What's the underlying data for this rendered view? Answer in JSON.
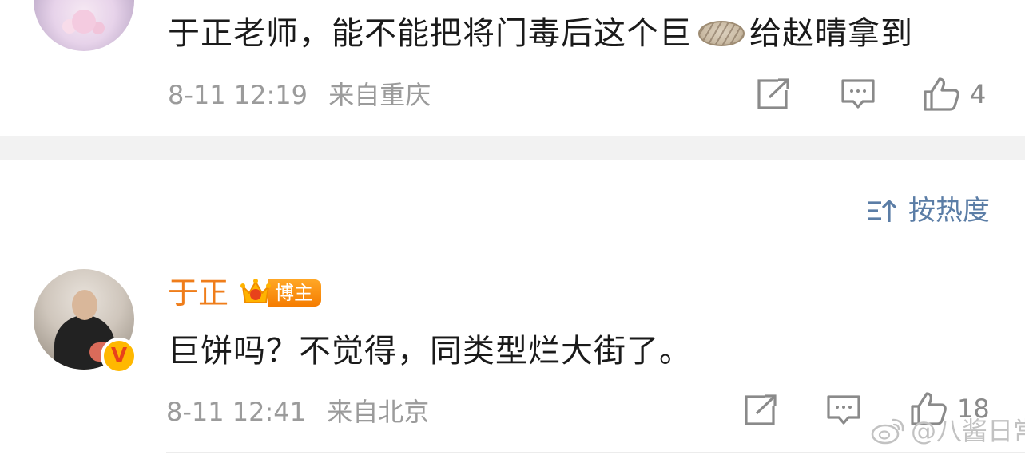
{
  "comment1": {
    "text_before": "于正老师，能不能把将门毒后这个巨",
    "emoji_icon": "cookie-emoji-icon",
    "text_after": "给赵晴拿到",
    "date": "8-11 12:19",
    "location": "来自重庆",
    "like_count": "4"
  },
  "sort": {
    "label": "按热度",
    "icon": "sort-hot-icon"
  },
  "comment2": {
    "username": "于正",
    "badge_label": "博主",
    "verified_mark": "V",
    "text": "巨饼吗？不觉得，同类型烂大街了。",
    "date": "8-11 12:41",
    "location": "来自北京",
    "like_count": "18"
  },
  "watermark": {
    "text": "@八酱日常"
  },
  "colors": {
    "username": "#ef7d1a",
    "sort_accent": "#5b7da6",
    "meta_gray": "#9b9b9b",
    "divider": "#f2f2f2",
    "badge_orange": "#f57c00",
    "verified_yellow": "#ffb800"
  }
}
